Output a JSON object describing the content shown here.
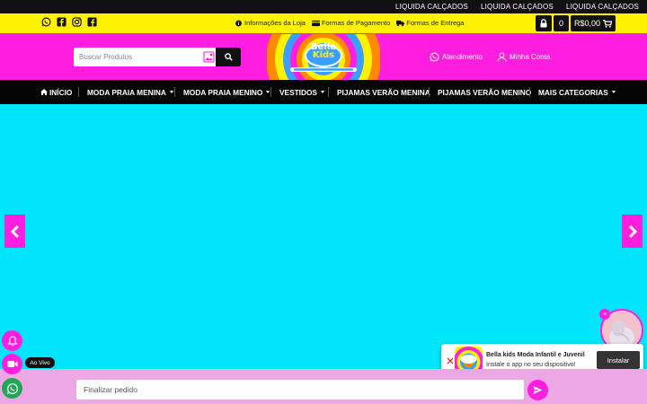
{
  "topbar": {
    "links": [
      "LIQUIDA CALÇADOS",
      "LIQUIDA CALÇADOS",
      "LIQUIDA CALÇADOS"
    ]
  },
  "infobar": {
    "social_icons": [
      "whatsapp-icon",
      "facebook-f-icon",
      "instagram-icon",
      "facebook-square-icon"
    ],
    "links": [
      {
        "label": "Informações da Loja",
        "icon": "info-icon"
      },
      {
        "label": "Formas de Pagamento",
        "icon": "credit-card-icon"
      },
      {
        "label": "Formas de Entrega",
        "icon": "truck-icon"
      }
    ],
    "cart_count": "0",
    "cart_total": "R$0,00"
  },
  "header": {
    "search_placeholder": "Buscar Produtos",
    "logo_text_line1": "Bella",
    "logo_text_line2": "Kids",
    "atendimento": "Atendimento",
    "minha_conta": "Minha Conta"
  },
  "nav": {
    "items": [
      {
        "label": "INÍCIO",
        "has_dropdown": false
      },
      {
        "label": "MODA PRAIA MENINA",
        "has_dropdown": true
      },
      {
        "label": "MODA PRAIA MENINO",
        "has_dropdown": true
      },
      {
        "label": "VESTIDOS",
        "has_dropdown": true
      },
      {
        "label": "PIJAMAS VERÃO MENINA",
        "has_dropdown": false
      },
      {
        "label": "PIJAMAS VERÃO MENINO",
        "has_dropdown": false
      },
      {
        "label": "MAIS CATEGORIAS",
        "has_dropdown": true
      }
    ]
  },
  "floating": {
    "live_label": "Ao Vivo"
  },
  "install_prompt": {
    "app_name": "Bella kids Moda Infantil e Juvenil",
    "description": "Instale o app no seu dispositivo!",
    "button_label": "Instalar"
  },
  "chat": {
    "placeholder": "Finalizar pedido"
  },
  "colors": {
    "brand_pink": "#ff1ee0",
    "brand_yellow": "#fff200",
    "banner_cyan": "#00e5fa",
    "whatsapp_green": "#1fa855"
  }
}
